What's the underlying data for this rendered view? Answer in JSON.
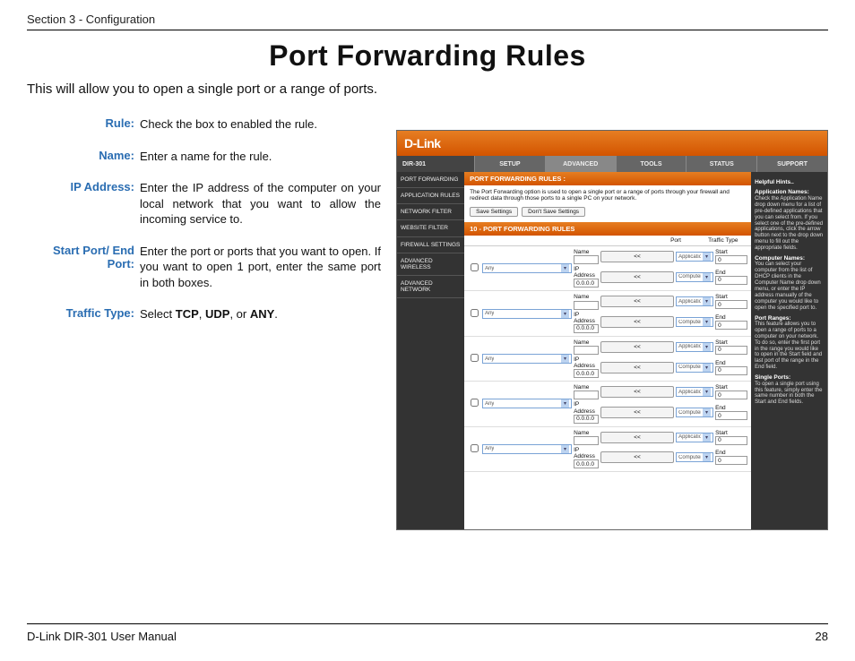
{
  "section_header": "Section 3 - Configuration",
  "title": "Port Forwarding Rules",
  "intro": "This will allow you to open a single port or a range of ports.",
  "defs": [
    {
      "term": "Rule:",
      "desc": "Check the box to enabled the rule."
    },
    {
      "term": "Name:",
      "desc": "Enter a name for the rule."
    },
    {
      "term": "IP Address:",
      "desc": "Enter the IP address of the computer on your local network that you want to allow the incoming service to."
    },
    {
      "term": "Start Port/ End Port:",
      "desc": "Enter the port or ports that you want to open. If you want to open 1 port, enter the same port in both boxes."
    }
  ],
  "traffic_term": "Traffic Type:",
  "traffic_pre": "Select ",
  "traffic_tcp": "TCP",
  "traffic_sep1": ", ",
  "traffic_udp": "UDP",
  "traffic_sep2": ", or ",
  "traffic_any": "ANY",
  "traffic_post": ".",
  "shot": {
    "brand": "D-Link",
    "model": "DIR-301",
    "tabs": [
      "SETUP",
      "ADVANCED",
      "TOOLS",
      "STATUS",
      "SUPPORT"
    ],
    "leftnav": [
      "PORT FORWARDING",
      "APPLICATION RULES",
      "NETWORK FILTER",
      "WEBSITE FILTER",
      "FIREWALL SETTINGS",
      "ADVANCED WIRELESS",
      "ADVANCED NETWORK"
    ],
    "panel_title": "PORT FORWARDING RULES :",
    "panel_desc": "The Port Forwarding option is used to open a single port or a range of ports through your firewall and redirect data through those ports to a single PC on your network.",
    "btn_save": "Save Settings",
    "btn_dont": "Don't Save Settings",
    "rules_title": "10 - PORT FORWARDING RULES",
    "col_port": "Port",
    "col_traffic": "Traffic Type",
    "lbl_name": "Name",
    "lbl_ip": "IP Address",
    "lbl_start": "Start",
    "lbl_end": "End",
    "val_ip": "0.0.0.0",
    "val_zero": "0",
    "btn_lt": "<<",
    "sel_app": "Application Name",
    "sel_comp": "Computer Name",
    "sel_any": "Any",
    "help": {
      "title": "Helpful Hints..",
      "h1": "Application Names:",
      "t1": "Check the Application Name drop down menu for a list of pre-defined applications that you can select from. If you select one of the pre-defined applications, click the arrow button next to the drop down menu to fill out the appropriate fields.",
      "h2": "Computer Names:",
      "t2": "You can select your computer from the list of DHCP clients in the Computer Name drop down menu, or enter the IP address manually of the computer you would like to open the specified port to.",
      "h3": "Port Ranges:",
      "t3": "This feature allows you to open a range of ports to a computer on your network. To do so, enter the first port in the range you would like to open in the Start field and last port of the range in the End field.",
      "h4": "Single Ports:",
      "t4": "To open a single port using this feature, simply enter the same number in both the Start and End fields."
    }
  },
  "footer_left": "D-Link DIR-301 User Manual",
  "footer_right": "28"
}
